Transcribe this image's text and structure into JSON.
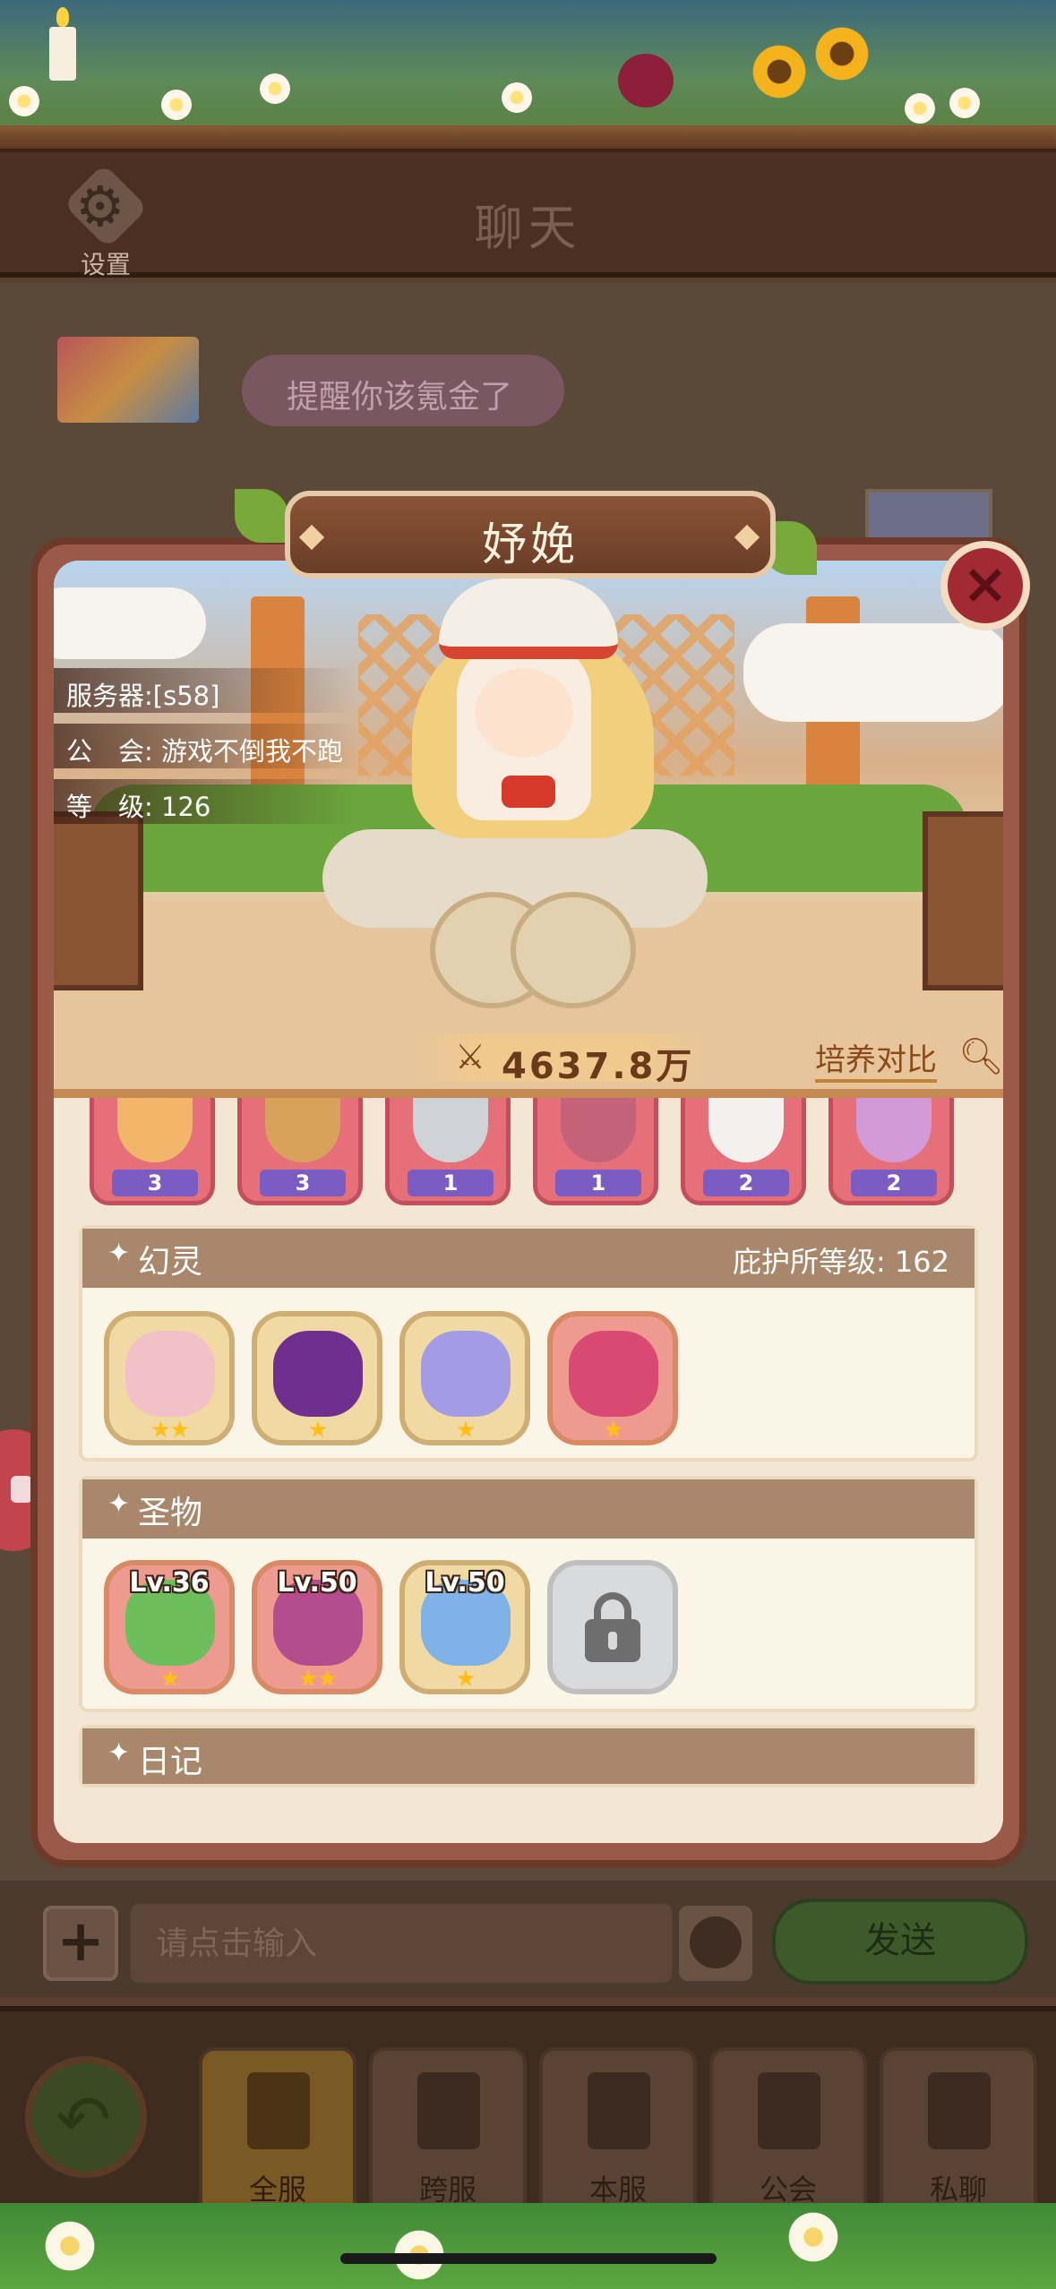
{
  "header": {
    "settings_label": "设置",
    "title": "聊天"
  },
  "chat": {
    "messages": [
      {
        "text": "提醒你该氪金了"
      }
    ]
  },
  "profile": {
    "name": "妤娩",
    "server": "服务器:[s58]",
    "guild": "公　会: 游戏不倒我不跑",
    "level": "等　级: 126",
    "power": "4637.8万",
    "compare_label": "培养对比",
    "heroes": [
      {
        "stars": "3",
        "color": "#f3b56a"
      },
      {
        "stars": "3",
        "color": "#d9a25a"
      },
      {
        "stars": "1",
        "color": "#cfd3d8"
      },
      {
        "stars": "1",
        "color": "#c4627a"
      },
      {
        "stars": "2",
        "color": "#f4f0ee"
      },
      {
        "stars": "2",
        "color": "#d39ad8"
      }
    ]
  },
  "sections": {
    "phantom": {
      "title": "幻灵",
      "extra": "庇护所等级: 162",
      "items": [
        {
          "stars": "★★",
          "color": "#f2c1c8"
        },
        {
          "stars": "★",
          "color": "#6f2f8e"
        },
        {
          "stars": "★",
          "color": "#a39be3"
        },
        {
          "stars": "★",
          "color": "#d94a73"
        }
      ]
    },
    "relics": {
      "title": "圣物",
      "items": [
        {
          "level": "Lv.36",
          "stars": "★",
          "color": "#6cbd5c",
          "locked": false
        },
        {
          "level": "Lv.50",
          "stars": "★★",
          "color": "#b44d8e",
          "locked": false
        },
        {
          "level": "Lv.50",
          "stars": "★",
          "color": "#7fb2e6",
          "locked": false
        },
        {
          "level": "",
          "stars": "",
          "color": "#d9dadc",
          "locked": true
        }
      ]
    },
    "diary": {
      "title": "日记"
    }
  },
  "input": {
    "placeholder": "请点击输入",
    "send_label": "发送"
  },
  "nav": {
    "tabs": [
      {
        "label": "全服",
        "active": true
      },
      {
        "label": "跨服",
        "active": false
      },
      {
        "label": "本服",
        "active": false
      },
      {
        "label": "公会",
        "active": false
      },
      {
        "label": "私聊",
        "active": false
      }
    ]
  },
  "colors": {
    "accent": "#a22a35",
    "section_header": "#a9876b",
    "send_button": "#3f5a2a"
  }
}
